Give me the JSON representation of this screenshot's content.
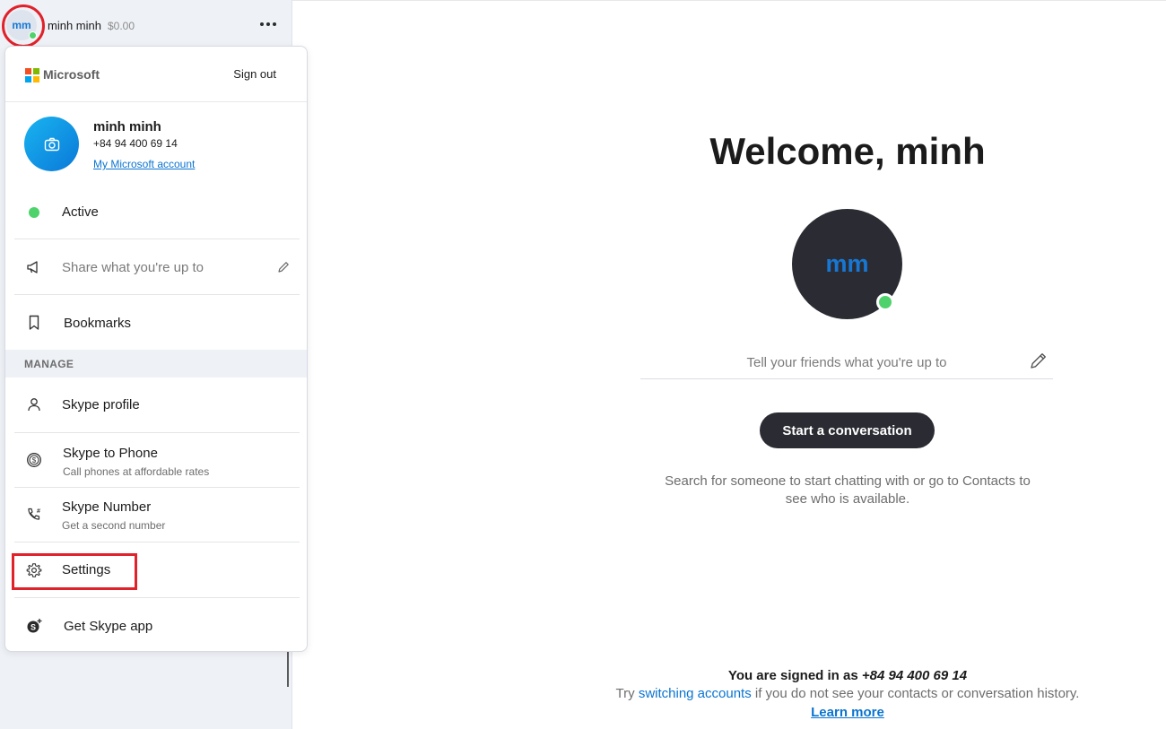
{
  "sidebar": {
    "avatar_initials": "mm",
    "user_name": "minh minh",
    "credit": "$0.00"
  },
  "panel": {
    "brand": "Microsoft",
    "sign_out": "Sign out",
    "profile": {
      "name": "minh minh",
      "phone": "+84 94 400 69 14",
      "account_link": "My Microsoft account"
    },
    "status": "Active",
    "share_placeholder": "Share what you're up to",
    "bookmarks": "Bookmarks",
    "manage_header": "MANAGE",
    "items": [
      {
        "label": "Skype profile",
        "sub": ""
      },
      {
        "label": "Skype to Phone",
        "sub": "Call phones at affordable rates"
      },
      {
        "label": "Skype Number",
        "sub": "Get a second number"
      },
      {
        "label": "Settings",
        "sub": ""
      },
      {
        "label": "Get Skype app",
        "sub": ""
      }
    ]
  },
  "main": {
    "welcome": "Welcome, minh",
    "avatar_initials": "mm",
    "mood_placeholder": "Tell your friends what you're up to",
    "start_button": "Start a conversation",
    "hint": "Search for someone to start chatting with or go to Contacts to see who is available.",
    "signed_in_prefix": "You are signed in as ",
    "signed_in_id": "+84 94 400 69 14",
    "try_prefix": "Try ",
    "switch_link": "switching accounts",
    "try_suffix": " if you do not see your contacts or conversation history.",
    "learn_more": "Learn more"
  },
  "colors": {
    "accent": "#0a74d1",
    "presence": "#4fd26b",
    "highlight": "#e0222b",
    "dark_button": "#2b2c33"
  }
}
